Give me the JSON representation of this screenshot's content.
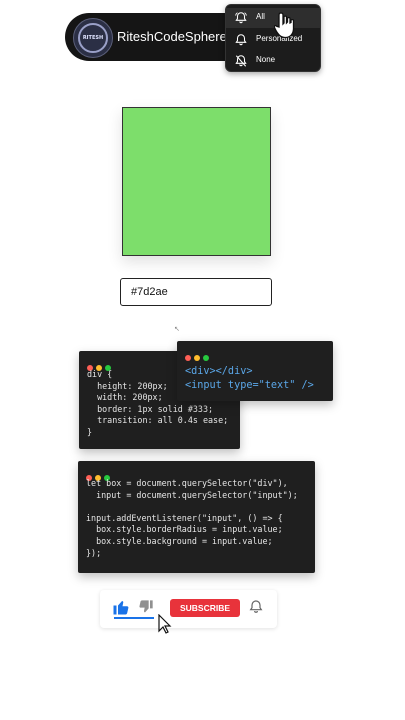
{
  "channel": {
    "name": "RiteshCodeSphere",
    "avatar_text": "RITESH"
  },
  "notification_menu": {
    "items": [
      {
        "label": "All",
        "icon": "bell-ringing-icon",
        "active": true
      },
      {
        "label": "Personalized",
        "icon": "bell-icon",
        "active": false
      },
      {
        "label": "None",
        "icon": "bell-off-icon",
        "active": false
      }
    ]
  },
  "preview": {
    "color": "#7dde6b"
  },
  "input": {
    "value": "#7d2ae"
  },
  "code": {
    "css_lines": [
      "div {",
      "  height: 200px;",
      "  width: 200px;",
      "  border: 1px solid #333;",
      "  transition: all 0.4s ease;",
      "}"
    ],
    "html_lines": [
      "<div></div>",
      "<input type=\"text\" />"
    ],
    "js_lines": [
      "let box = document.querySelector(\"div\"),",
      "  input = document.querySelector(\"input\");",
      "",
      "input.addEventListener(\"input\", () => {",
      "  box.style.borderRadius = input.value;",
      "  box.style.background = input.value;",
      "});"
    ]
  },
  "actions": {
    "subscribe_label": "SUBSCRIBE",
    "colors": {
      "subscribe": "#e8333b",
      "like": "#1a73e8"
    }
  }
}
